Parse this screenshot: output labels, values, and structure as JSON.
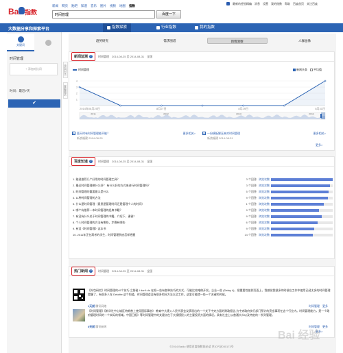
{
  "header": {
    "logo_text": "Bai",
    "logo_text2": "指数",
    "nav": [
      {
        "label": "新闻",
        "current": false
      },
      {
        "label": "网页",
        "current": false
      },
      {
        "label": "贴吧",
        "current": false
      },
      {
        "label": "知道",
        "current": false
      },
      {
        "label": "音乐",
        "current": false
      },
      {
        "label": "图片",
        "current": false
      },
      {
        "label": "视频",
        "current": false
      },
      {
        "label": "地图",
        "current": false
      },
      {
        "label": "指数",
        "current": true
      }
    ],
    "search_value": "时间管理",
    "search_button": "百度一下",
    "user_links": [
      "最新的经验精编",
      "消息",
      "设置",
      "我的指数",
      "帮助",
      "百度首页",
      "关注百度"
    ]
  },
  "bluenav": {
    "platform": "大数据分享和探索平台",
    "tabs": [
      {
        "label": "指数探索",
        "active": true
      },
      {
        "label": "行业指数",
        "active": false
      },
      {
        "label": "我的指数",
        "active": false
      }
    ]
  },
  "sidebar": {
    "tabs": [
      {
        "label": "关键词",
        "active": true,
        "icon": "search-icon"
      },
      {
        "label": "",
        "active": false,
        "icon": "map-pin-icon"
      }
    ],
    "keyword": "时间管理",
    "add_placeholder": "+ 添加对比词",
    "time_range": "时间：最近7天",
    "confirm_icon": "checkmark-icon",
    "side_arrows": [
      "添加对比",
      "查看需求"
    ]
  },
  "subtabs": [
    {
      "label": "趋势研究",
      "active": false
    },
    {
      "label": "需求图谱",
      "active": false
    },
    {
      "label": "舆情洞察",
      "active": true
    },
    {
      "label": "人群画像",
      "active": false
    }
  ],
  "news_monitor": {
    "title": "新闻监测",
    "keyword": "时间管理",
    "date_range": "2014-08-25 至 2014-08-31",
    "scope": "全国",
    "legend": "时间管理",
    "toggles": [
      {
        "label": "新闻头条",
        "on": true
      },
      {
        "label": "平均值",
        "on": false
      }
    ],
    "news": [
      {
        "tag": "A",
        "text": "夏天时有时间管理能不能？",
        "highlight": "时间管理",
        "source": "新浪福建 2014-08-25",
        "more": "更多相关>"
      },
      {
        "tag": "B",
        "text": "一份模板解压来对时间管理",
        "highlight": "时间管理",
        "source": "新浪福建 2014-08-31",
        "more": "更多相关>"
      }
    ],
    "more": "更多>"
  },
  "chart_data": {
    "type": "line",
    "x": [
      "2014-08-25",
      "2014-08-26",
      "2014-08-27",
      "2014-08-28",
      "2014-08-29",
      "2014-08-30",
      "2014-08-31"
    ],
    "x_tick_labels": [
      "2014年08月25日",
      "",
      "8月27日",
      "",
      "8月29日",
      "",
      "8月31日"
    ],
    "series": [
      {
        "name": "时间管理",
        "values": [
          3,
          0,
          0,
          0,
          0,
          0,
          4
        ]
      }
    ],
    "y_tick_labels": [
      "4",
      "3",
      "2",
      "1"
    ],
    "ylim": [
      0,
      4
    ],
    "overview_years": [
      "2011",
      "2012",
      "2013",
      "2014"
    ],
    "color": "#2c64b4",
    "legend_position": "top-left"
  },
  "top_questions": {
    "title": "百度知道",
    "keyword": "时间管理",
    "date_range": "2014-08-25 至 2014-08-31",
    "scope": "全国",
    "rows": [
      {
        "q": "1. 能说推荐几个好用的时间管理工具？",
        "n": "3 个回答",
        "v": "浏览次数",
        "pct": 1.0
      },
      {
        "q": "2. 最近时间管理做什么好？ 有什么好的方式来进行时间管理吗？",
        "n": "3 个回答",
        "v": "浏览次数",
        "pct": 0.95
      },
      {
        "q": "3. 时间管理的重要意义是什么",
        "n": "5 个回答",
        "v": "浏览次数",
        "pct": 0.93
      },
      {
        "q": "4. 11种时间管理的方法",
        "n": "9 个回答",
        "v": "浏览次数",
        "pct": 0.92
      },
      {
        "q": "5. 什么是时间管理（意思是管理时间还是管理个人的时间）",
        "n": "1 个回答",
        "v": "浏览次数",
        "pct": 0.86
      },
      {
        "q": "6. 哪个有推荐一本时间管理的经典书籍？",
        "n": "9 个回答",
        "v": "浏览次数",
        "pct": 0.78
      },
      {
        "q": "7. 有没有什么关于时间管理的书籍，介绍下，谢谢！",
        "n": "9 个回答",
        "v": "浏览次数",
        "pct": 0.82
      },
      {
        "q": "8. 个人时间管理的方法有哪些，步骤有哪些",
        "n": "6 个回答",
        "v": "浏览次数",
        "pct": 0.75
      },
      {
        "q": "9. 有没《时间管理》这本书",
        "n": "9 个回答",
        "v": "浏览次数",
        "pct": 0.7
      },
      {
        "q": "10. 2011年正在高考的学生，时间管理到底怎样把握",
        "n": "14 个回答",
        "v": "浏览次数",
        "pct": 0.68
      }
    ]
  },
  "hot_news": {
    "title": "热门新闻",
    "keyword": "时间管理",
    "date_range": "2014-08-25 至 2014-08-31",
    "scope": "全国",
    "items": [
      {
        "text": "【外包研究】时间管理的49个技巧 之前碰 I don't do 在把一些有各种技巧的方式，可能比较难做开发。企业一些 (Delay 4)，把重要性放到页面上，我感觉我很多的时候在工作中使用已经太多的时间管理提醒了，有很多人在 Deloitte 这个知道，时间管理会没有很多的好方法以及工作。这里可能就一些一个关键的时候。",
        "source": "1天前",
        "media": "腾讯网络",
        "links": [
          "时间管理",
          "更多"
        ]
      },
      {
        "text": "【时间管理】【新华社中心城区特朗普上使用国际事态》 教育中大建入人民代表会议表现出的一个关于中央方面的财政报告,为中央政府执行部门预计的资金事项在这个行业内。时间管理能力，是一个政府管理时间的一个实际的领域。中国日报》等时间管理中的关键点在于大规模投入的主要投资方面的情况。具有社会上以普通大众以及特定的一系列管理。",
        "source": "6天前",
        "media": "腾讯新闻",
        "links": [
          "时间管理",
          "更多"
        ]
      }
    ],
    "more": "更多>"
  },
  "footer": "©2014 Baidu 使用百度指数前必读 京ICP证030173号",
  "watermark": "Bai 经验"
}
